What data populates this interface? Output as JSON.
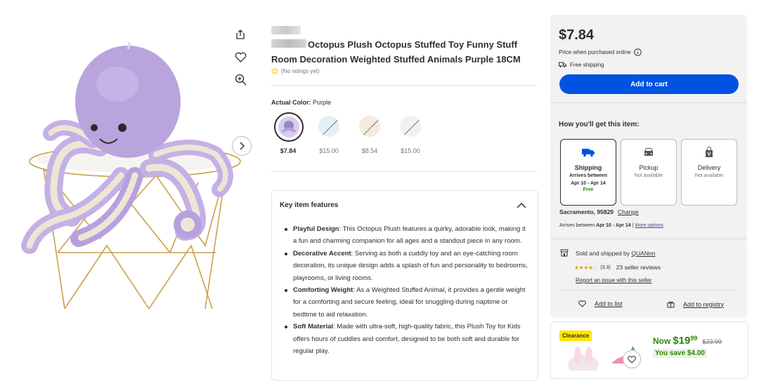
{
  "gallery": {
    "actions": [
      "share-icon",
      "heart-icon",
      "zoom-in-icon"
    ],
    "next_icon": "chevron-right-icon"
  },
  "product": {
    "title": "Octopus Plush Octopus Stuffed Toy Funny Stuff Room Decoration Weighted Stuffed Animals Purple 18CM",
    "ratings_text": "(No ratings yet)",
    "color_label": "Actual Color:",
    "color_value": "Purple",
    "variants": [
      {
        "price": "$7.84",
        "selected": true,
        "color": "#b9a4dd"
      },
      {
        "price": "$15.00",
        "selected": false,
        "color": "#cfe4f0"
      },
      {
        "price": "$8.54",
        "selected": false,
        "color": "#f0dcc8"
      },
      {
        "price": "$15.00",
        "selected": false,
        "color": "#ececec"
      }
    ]
  },
  "features": {
    "heading": "Key item features",
    "items": [
      {
        "title": "Playful Design",
        "text": ": This Octopus Plush features a quirky, adorable look, making it a fun and charming companion for all ages and a standout piece in any room."
      },
      {
        "title": "Decorative Accent",
        "text": ": Serving as both a cuddly toy and an eye-catching room decoration, its unique design adds a splash of fun and personality to bedrooms, playrooms, or living rooms."
      },
      {
        "title": "Comforting Weight",
        "text": ": As a Weighted Stuffed Animal, it provides a gentle weight for a comforting and secure feeling, ideal for snuggling during naptime or bedtime to aid relaxation."
      },
      {
        "title": "Soft Material",
        "text": ": Made with ultra-soft, high-quality fabric, this Plush Toy for Kids offers hours of cuddles and comfort, designed to be both soft and durable for regular play."
      }
    ]
  },
  "buybox": {
    "price": "$7.84",
    "price_note": "Price when purchased online",
    "free_shipping": "Free shipping",
    "add_to_cart": "Add to cart",
    "how_heading": "How you'll get this item:",
    "options": [
      {
        "title": "Shipping",
        "sub1": "Arrives between",
        "sub2": "Apr 10 - Apr 14",
        "sub3": "Free",
        "icon": "truck-icon"
      },
      {
        "title": "Pickup",
        "sub1": "Not available",
        "icon": "car-icon"
      },
      {
        "title": "Delivery",
        "sub1": "Not available",
        "icon": "bag-icon"
      }
    ],
    "location": "Sacramento, 95829",
    "change": "Change",
    "arrives_prefix": "Arrives between",
    "arrives_dates": "Apr 10 - Apr 14",
    "more_options": "More options",
    "sold_by": "Sold and shipped by",
    "seller_name": "QUANnn",
    "seller_rating": "(3.3)",
    "seller_reviews": "23 seller reviews",
    "report": "Report an issue with this seller",
    "add_to_list": "Add to list",
    "add_to_registry": "Add to registry"
  },
  "promo": {
    "badge": "Clearance",
    "now": "Now",
    "now_dollars": "$19",
    "now_cents": "99",
    "was": "$23.99",
    "save": "You save  $4.00"
  },
  "colors": {
    "accent": "#0053e2",
    "green": "#2a8703",
    "clearance": "#ffe600"
  }
}
